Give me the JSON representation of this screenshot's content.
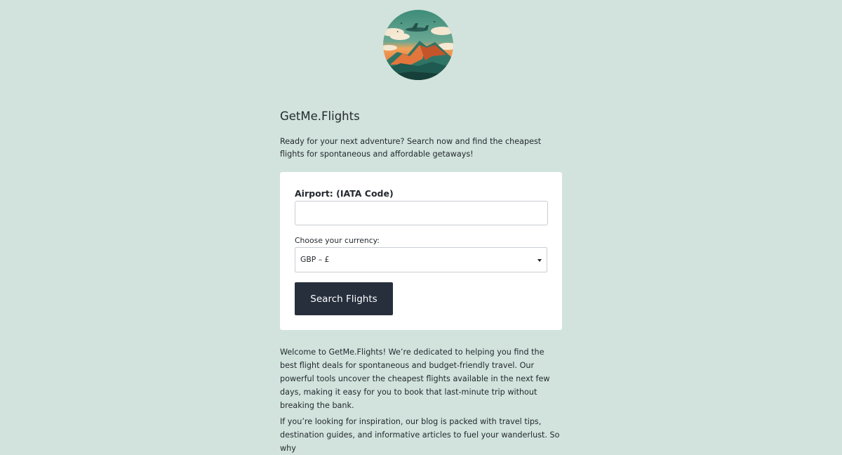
{
  "brand": {
    "logo_icon": "airplane-over-mountains-logo-icon",
    "site_title": "GetMe.Flights"
  },
  "intro": "Ready for your next adventure? Search now and find the cheapest flights for spontaneous and affordable getaways!",
  "search_form": {
    "airport_label": "Airport: (IATA Code)",
    "airport_value": "",
    "currency_label": "Choose your currency:",
    "currency_selected": "GBP – £",
    "submit_label": "Search Flights"
  },
  "about": {
    "paragraph_1": "Welcome to GetMe.Flights! We’re dedicated to helping you find the best flight deals for spontaneous and budget-friendly travel. Our powerful tools uncover the cheapest flights available in the next few days, making it easy for you to book that last-minute trip without breaking the bank.",
    "paragraph_2": "If you’re looking for inspiration, our blog is packed with travel tips, destination guides, and informative articles to fuel your wanderlust. So why"
  },
  "colors": {
    "page_background": "#d1e3dc",
    "card_background": "#ffffff",
    "button_background": "#272f3d",
    "text": "#24292f"
  }
}
